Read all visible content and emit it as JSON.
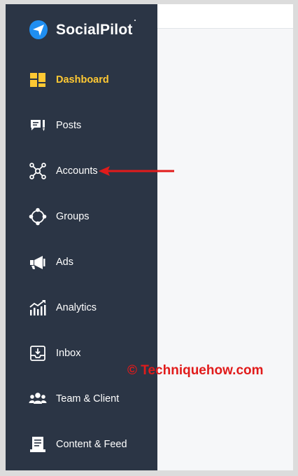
{
  "app": {
    "name": "SocialPilot"
  },
  "colors": {
    "sidebar": "#2b3545",
    "active": "#ffc933",
    "text": "#ffffff",
    "accent": "#1f8ef1",
    "annotation": "#e11b1b"
  },
  "nav": {
    "items": [
      {
        "label": "Dashboard",
        "icon": "dashboard-icon",
        "active": true
      },
      {
        "label": "Posts",
        "icon": "posts-icon"
      },
      {
        "label": "Accounts",
        "icon": "accounts-icon"
      },
      {
        "label": "Groups",
        "icon": "groups-icon"
      },
      {
        "label": "Ads",
        "icon": "megaphone-icon"
      },
      {
        "label": "Analytics",
        "icon": "analytics-icon"
      },
      {
        "label": "Inbox",
        "icon": "inbox-icon"
      },
      {
        "label": "Team & Client",
        "icon": "team-icon"
      },
      {
        "label": "Content & Feed",
        "icon": "content-icon"
      }
    ]
  },
  "annotation": {
    "watermark": "© Techniquehow.com",
    "arrow_target": "Accounts"
  }
}
